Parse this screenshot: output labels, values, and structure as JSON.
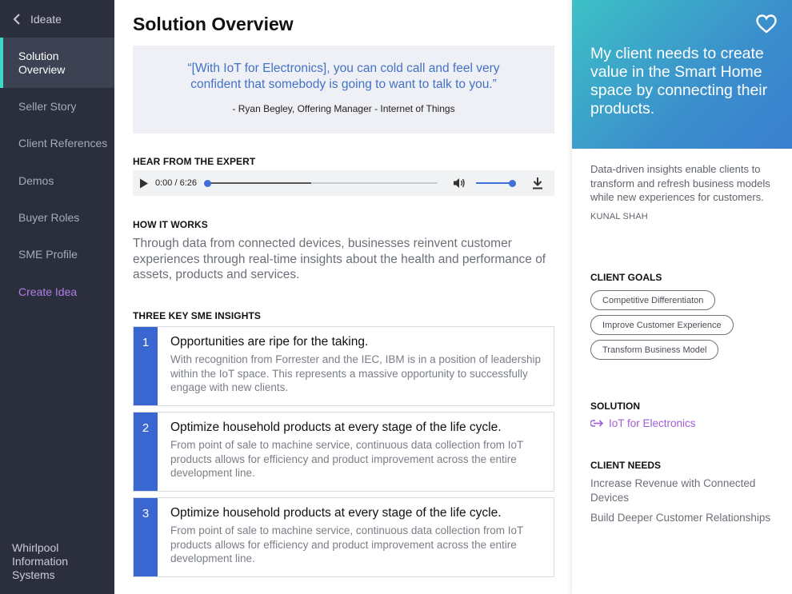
{
  "sidebar": {
    "back_label": "Ideate",
    "items": [
      {
        "label": "Solution Overview"
      },
      {
        "label": "Seller Story"
      },
      {
        "label": "Client References"
      },
      {
        "label": "Demos"
      },
      {
        "label": "Buyer Roles"
      },
      {
        "label": "SME Profile"
      },
      {
        "label": "Create Idea"
      }
    ],
    "footer": "Whirlpool Information Systems",
    "active_accent": "#3ddbc7",
    "create_color": "#b07ee8"
  },
  "main": {
    "title": "Solution Overview",
    "quote": {
      "text": "“[With IoT for Electronics], you can cold call and feel very confident that somebody is going to want to talk to you.”",
      "author": "- Ryan Begley, Offering Manager - Internet of Things"
    },
    "expert": {
      "heading": "HEAR FROM THE EXPERT",
      "time": "0:00 / 6:26",
      "buffered_fraction": 0.45,
      "volume_fraction": 0.9,
      "icons": [
        "play-icon",
        "volume-icon",
        "download-icon"
      ]
    },
    "how": {
      "heading": "HOW IT WORKS",
      "text": "Through data from connected devices, businesses reinvent customer experiences through real-time insights about the health and performance of assets, products and services."
    },
    "insights": {
      "heading": "THREE KEY SME INSIGHTS",
      "items": [
        {
          "num": "1",
          "title": "Opportunities are ripe for the taking.",
          "body": "With recognition from Forrester and the IEC, IBM is in a position of leadership within the IoT space. This represents a massive opportunity to successfully engage with new clients."
        },
        {
          "num": "2",
          "title": "Optimize household products at every stage of the life cycle.",
          "body": "From point of sale to machine service, continuous data collection from IoT products allows for efficiency and product improvement across the entire development line."
        },
        {
          "num": "3",
          "title": "Optimize household products at every stage of the life cycle.",
          "body": "From point of sale to machine service, continuous data collection from IoT products allows for efficiency and product improvement across the entire development line."
        }
      ],
      "accent": "#3a66d1"
    }
  },
  "right": {
    "hero_text": "My client needs to create value in the Smart Home space by connecting their products.",
    "description": "Data-driven insights enable clients to transform and refresh business models while   new experiences for customers.",
    "person": "KUNAL SHAH",
    "goals_heading": "CLIENT GOALS",
    "goals": [
      "Competitive Differentiaton",
      "Improve Customer Experience",
      "Transform Business Model"
    ],
    "solution_heading": "SOLUTION",
    "solution_link": "IoT for Electronics",
    "needs_heading": "CLIENT NEEDS",
    "needs": [
      "Increase Revenue with Connected Devices",
      "Build Deeper Customer Relationships"
    ],
    "link_color": "#a05cd6"
  }
}
